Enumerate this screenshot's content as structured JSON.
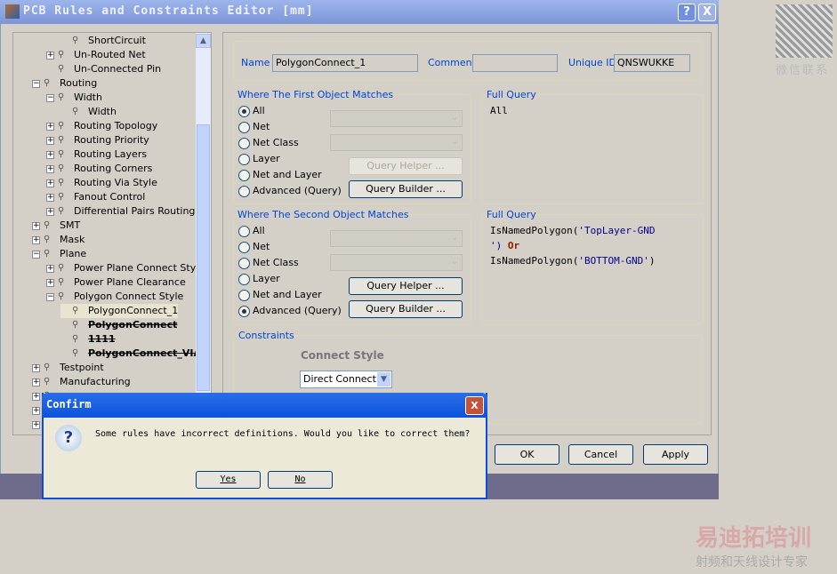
{
  "window": {
    "title": "PCB Rules and Constraints Editor [mm]",
    "help": "?",
    "close": "X"
  },
  "tree": {
    "items": [
      {
        "label": "ShortCircuit",
        "level": 2,
        "exp": "",
        "strike": false
      },
      {
        "label": "Un-Routed Net",
        "level": 1,
        "exp": "+",
        "strike": false
      },
      {
        "label": "Un-Connected Pin",
        "level": 1,
        "exp": "",
        "strike": false
      },
      {
        "label": "Routing",
        "level": 0,
        "exp": "−",
        "strike": false
      },
      {
        "label": "Width",
        "level": 1,
        "exp": "−",
        "strike": false
      },
      {
        "label": "Width",
        "level": 2,
        "exp": "",
        "strike": false
      },
      {
        "label": "Routing Topology",
        "level": 1,
        "exp": "+",
        "strike": false
      },
      {
        "label": "Routing Priority",
        "level": 1,
        "exp": "+",
        "strike": false
      },
      {
        "label": "Routing Layers",
        "level": 1,
        "exp": "+",
        "strike": false
      },
      {
        "label": "Routing Corners",
        "level": 1,
        "exp": "+",
        "strike": false
      },
      {
        "label": "Routing Via Style",
        "level": 1,
        "exp": "+",
        "strike": false
      },
      {
        "label": "Fanout Control",
        "level": 1,
        "exp": "+",
        "strike": false
      },
      {
        "label": "Differential Pairs Routing",
        "level": 1,
        "exp": "+",
        "strike": false
      },
      {
        "label": "SMT",
        "level": 0,
        "exp": "+",
        "strike": false
      },
      {
        "label": "Mask",
        "level": 0,
        "exp": "+",
        "strike": false
      },
      {
        "label": "Plane",
        "level": 0,
        "exp": "−",
        "strike": false
      },
      {
        "label": "Power Plane Connect Style",
        "level": 1,
        "exp": "+",
        "strike": false
      },
      {
        "label": "Power Plane Clearance",
        "level": 1,
        "exp": "+",
        "strike": false
      },
      {
        "label": "Polygon Connect Style",
        "level": 1,
        "exp": "−",
        "strike": false
      },
      {
        "label": "PolygonConnect_1",
        "level": 2,
        "exp": "",
        "strike": false,
        "selected": true
      },
      {
        "label": "PolygonConnect",
        "level": 2,
        "exp": "",
        "strike": true
      },
      {
        "label": "1111",
        "level": 2,
        "exp": "",
        "strike": true
      },
      {
        "label": "PolygonConnect_VIA",
        "level": 2,
        "exp": "",
        "strike": true
      },
      {
        "label": "Testpoint",
        "level": 0,
        "exp": "+",
        "strike": false
      },
      {
        "label": "Manufacturing",
        "level": 0,
        "exp": "+",
        "strike": false
      },
      {
        "label": "",
        "level": 0,
        "exp": "+",
        "strike": false
      },
      {
        "label": "",
        "level": 0,
        "exp": "+",
        "strike": false
      },
      {
        "label": "",
        "level": 0,
        "exp": "+",
        "strike": false
      }
    ]
  },
  "rule": {
    "name_label": "Name",
    "name": "PolygonConnect_1",
    "comment_label": "Comment",
    "comment": "",
    "uid_label": "Unique ID",
    "uid": "QNSWUKKE"
  },
  "first": {
    "title": "Where The First Object Matches",
    "options": [
      "All",
      "Net",
      "Net Class",
      "Layer",
      "Net and Layer",
      "Advanced (Query)"
    ],
    "selected": 0,
    "query_helper": "Query Helper ...",
    "query_builder": "Query Builder ...",
    "full_query_label": "Full Query",
    "query": "All"
  },
  "second": {
    "title": "Where The Second Object Matches",
    "options": [
      "All",
      "Net",
      "Net Class",
      "Layer",
      "Net and Layer",
      "Advanced (Query)"
    ],
    "selected": 5,
    "query_helper": "Query Helper ...",
    "query_builder": "Query Builder ...",
    "full_query_label": "Full Query",
    "q_fn1": "IsNamedPolygon(",
    "q_str1": "'TopLayer-GND",
    "q_str1b": "')",
    "q_or": "Or",
    "q_fn2": "IsNamedPolygon(",
    "q_str2": "'BOTTOM-GND'",
    "q_end": ")"
  },
  "constraints": {
    "title": "Constraints",
    "connect_style_label": "Connect Style",
    "connect_style": "Direct Connect"
  },
  "buttons": {
    "ok": "OK",
    "cancel": "Cancel",
    "apply": "Apply"
  },
  "confirm": {
    "title": "Confirm",
    "message": "Some rules have incorrect definitions. Would you like to correct them?",
    "yes": "Yes",
    "no": "No",
    "close": "X"
  },
  "watermark": {
    "wechat": "微信联系",
    "brand": "易迪拓培训",
    "tagline": "射频和天线设计专家"
  }
}
